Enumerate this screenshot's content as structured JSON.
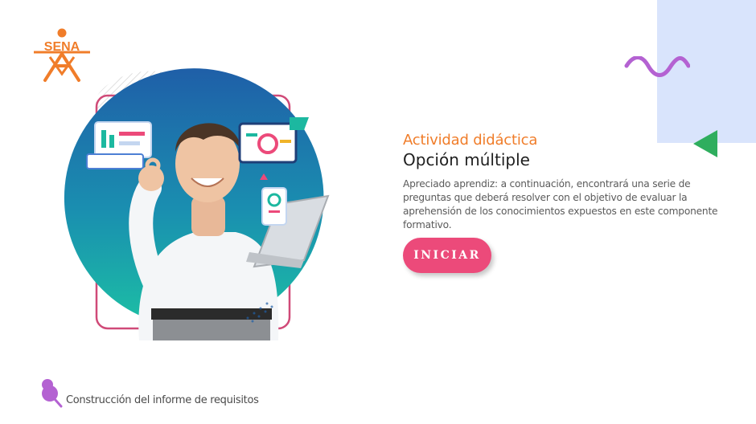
{
  "brand": {
    "logo_text": "SENA",
    "logo_color": "#f07d2a"
  },
  "activity": {
    "subtitle": "Actividad didáctica",
    "title": "Opción múltiple",
    "description": "Apreciado aprendiz: a continuación, encontrará una serie de preguntas que deberá resolver con el objetivo de evaluar la aprehensión de los conocimientos expuestos en este componente formativo."
  },
  "start_button": {
    "label": "INICIAR",
    "color": "#ec4a7a"
  },
  "footer": {
    "text": "Construcción del informe de requisitos",
    "icon": "push-pin-icon"
  },
  "decor": {
    "panel_color": "#d9e4fc",
    "wave_color": "#b462d2",
    "triangle_color": "#2fae5e",
    "accent_teal": "#1cb8a0",
    "accent_blue": "#1f5fa8"
  }
}
